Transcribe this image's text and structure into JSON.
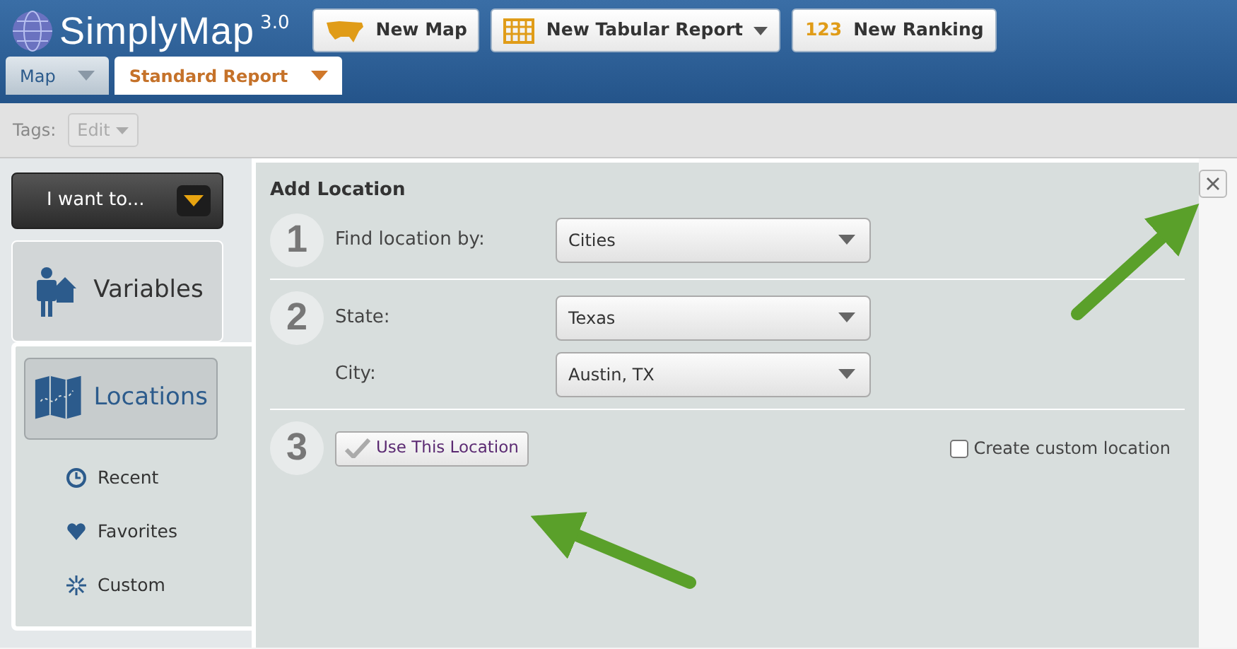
{
  "app": {
    "logo": "SimplyMap",
    "version": "3.0"
  },
  "header_buttons": [
    {
      "label": "New Map",
      "kind": "map",
      "dropdown": false
    },
    {
      "label": "New Tabular Report",
      "kind": "table",
      "dropdown": true
    },
    {
      "label": "New Ranking",
      "kind": "ranking",
      "icon_text": "123",
      "dropdown": false
    }
  ],
  "tabs": [
    {
      "label": "Map",
      "selected": false
    },
    {
      "label": "Standard Report",
      "selected": true
    }
  ],
  "toolbar": {
    "label": "Tags:",
    "button": "Edit",
    "disabled": true
  },
  "sidebar": {
    "menu_button": "I want to...",
    "sections": [
      {
        "label": "Variables",
        "kind": "variables",
        "selected": false
      },
      {
        "label": "Locations",
        "kind": "locations",
        "selected": true
      }
    ],
    "items": [
      {
        "label": "Recent",
        "kind": "clock"
      },
      {
        "label": "Favorites",
        "kind": "heart"
      },
      {
        "label": "Custom",
        "kind": "star"
      }
    ]
  },
  "panel": {
    "title": "Add Location",
    "steps": [
      {
        "number": "1",
        "fields": [
          {
            "label": "Find location by:",
            "value": "Cities"
          }
        ]
      },
      {
        "number": "2",
        "fields": [
          {
            "label": "State:",
            "value": "Texas"
          },
          {
            "label": "City:",
            "value": "Austin, TX"
          }
        ]
      },
      {
        "number": "3",
        "button": "Use This Location",
        "checkbox": {
          "label": "Create custom location",
          "checked": false
        }
      }
    ]
  },
  "callout_arrows": [
    {
      "kind": "arrow"
    },
    {
      "kind": "arrow"
    }
  ]
}
